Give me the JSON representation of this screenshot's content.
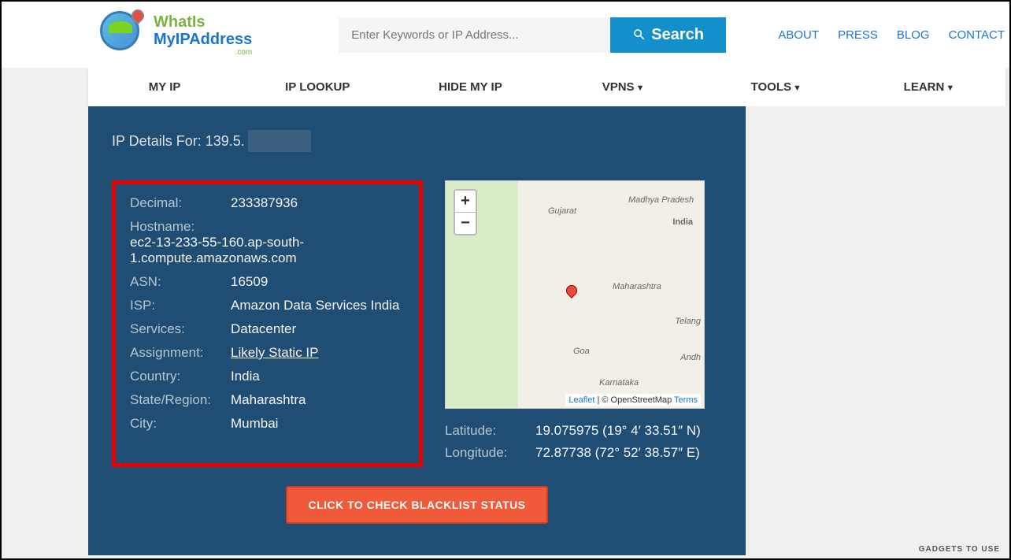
{
  "logo": {
    "line1": "WhatIs",
    "line2": "MyIPAddress",
    "line3": ".com"
  },
  "search": {
    "placeholder": "Enter Keywords or IP Address...",
    "button": "Search"
  },
  "topLinks": [
    "ABOUT",
    "PRESS",
    "BLOG",
    "CONTACT"
  ],
  "nav": [
    {
      "label": "MY IP",
      "dropdown": false
    },
    {
      "label": "IP LOOKUP",
      "dropdown": false
    },
    {
      "label": "HIDE MY IP",
      "dropdown": false
    },
    {
      "label": "VPNS",
      "dropdown": true
    },
    {
      "label": "TOOLS",
      "dropdown": true
    },
    {
      "label": "LEARN",
      "dropdown": true
    }
  ],
  "pageTitle": "IP Details For: 139.5.",
  "details": {
    "decimal": {
      "label": "Decimal:",
      "value": "233387936"
    },
    "hostname": {
      "label": "Hostname:",
      "value": "ec2-13-233-55-160.ap-south-1.compute.amazonaws.com"
    },
    "asn": {
      "label": "ASN:",
      "value": "16509"
    },
    "isp": {
      "label": "ISP:",
      "value": "Amazon Data Services India"
    },
    "services": {
      "label": "Services:",
      "value": "Datacenter"
    },
    "assignment": {
      "label": "Assignment:",
      "value": "Likely Static IP"
    },
    "country": {
      "label": "Country:",
      "value": "India"
    },
    "state": {
      "label": "State/Region:",
      "value": "Maharashtra"
    },
    "city": {
      "label": "City:",
      "value": "Mumbai"
    }
  },
  "map": {
    "zoomIn": "+",
    "zoomOut": "−",
    "labels": {
      "gujarat": "Gujarat",
      "mp": "Madhya Pradesh",
      "india": "India",
      "maharashtra": "Maharashtra",
      "telangana": "Telang",
      "goa": "Goa",
      "karnataka": "Karnataka",
      "andh": "Andh"
    },
    "credit": {
      "leaflet": "Leaflet",
      "sep": " | © ",
      "osm": "OpenStreetMap",
      "terms": "Terms"
    }
  },
  "coords": {
    "lat": {
      "label": "Latitude:",
      "value": "19.075975  (19° 4′ 33.51″ N)"
    },
    "lon": {
      "label": "Longitude:",
      "value": "72.87738  (72° 52′ 38.57″ E)"
    }
  },
  "blacklistBtn": "CLICK TO CHECK BLACKLIST STATUS",
  "watermark": "GADGETS TO USE"
}
